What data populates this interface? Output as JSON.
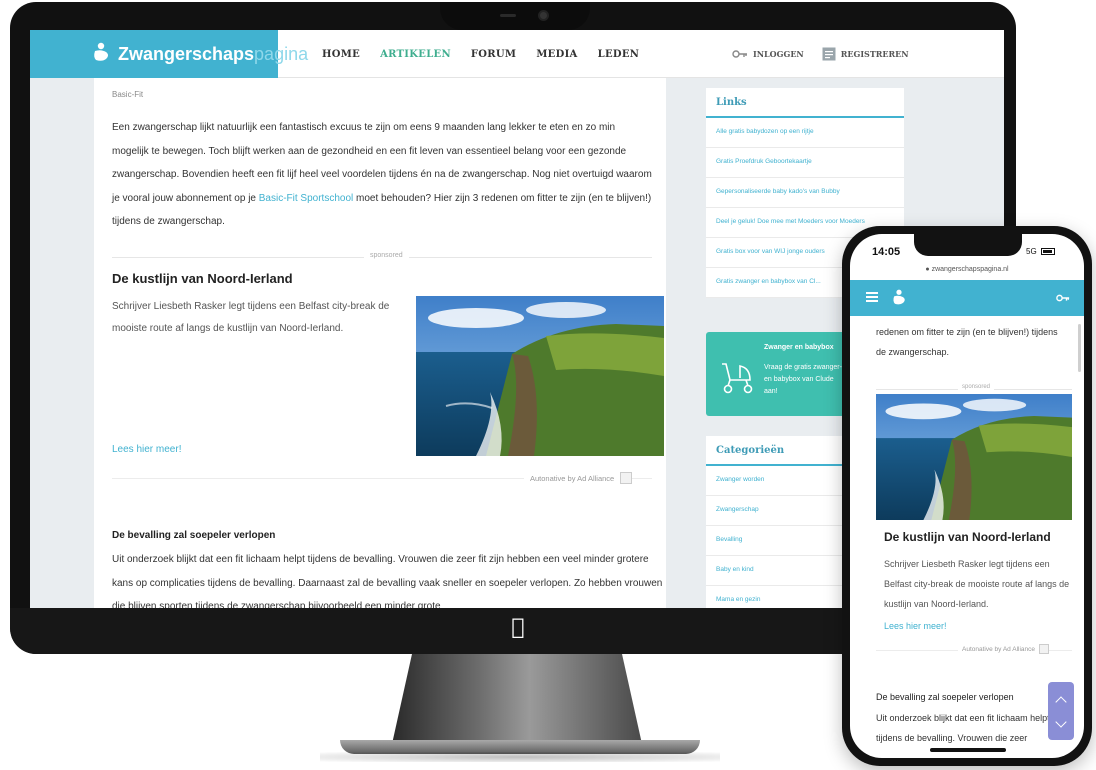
{
  "site": {
    "logo_bold": "Zwangerschaps",
    "logo_light": "pagina",
    "nav": [
      "HOME",
      "ARTIKELEN",
      "FORUM",
      "MEDIA",
      "LEDEN"
    ],
    "active_nav": "ARTIKELEN",
    "login_label": "INLOGGEN",
    "register_label": "REGISTREREN",
    "brand_color": "#41b2d0",
    "accent_color": "#3fae8f"
  },
  "article": {
    "breadcrumb": "Basic-Fit",
    "intro_before_link": "Een zwangerschap lijkt natuurlijk een fantastisch excuus te zijn om eens 9 maanden lang lekker te eten en zo min mogelijk te bewegen. Toch blijft werken aan de gezondheid en een fit leven van essentieel belang voor een gezonde zwangerschap. Bovendien heeft een fit lijf heel veel voordelen tijdens én na de zwangerschap. Nog niet overtuigd waarom je vooral jouw abonnement op je ",
    "intro_link": "Basic-Fit Sportschool",
    "intro_after_link": " moet behouden? Hier zijn 3 redenen om fitter te zijn (en te blijven!) tijdens de zwangerschap.",
    "sponsored_label": "sponsored",
    "ad_title": "De kustlijn van Noord-Ierland",
    "ad_desc": "Schrijver Liesbeth Rasker legt tijdens een Belfast city-break de mooiste route af langs de kustlijn van Noord-Ierland.",
    "ad_link": "Lees hier meer!",
    "ad_powered": "Autonative by Ad Alliance",
    "section_title": "De bevalling zal soepeler verlopen",
    "section_text": "Uit onderzoek blijkt dat een fit lichaam helpt tijdens de bevalling. Vrouwen die zeer fit zijn hebben een veel minder grotere kans op complicaties tijdens de bevalling. Daarnaast zal de bevalling vaak sneller en soepeler verlopen. Zo hebben vrouwen die blijven sporten tijdens de zwangerschap bijvoorbeeld een minder grote"
  },
  "sidebar": {
    "links_title": "Links",
    "links": [
      "Alle gratis babydozen op een rijtje",
      "Gratis Proefdruk Geboortekaartje",
      "Gepersonaliseerde baby kado's van Bubby",
      "Deel je geluk! Doe mee met Moeders voor Moeders",
      "Gratis box voor van WIJ jonge ouders",
      "Gratis zwanger en babybox van Cl..."
    ],
    "promo_title": "Zwanger en babybox",
    "promo_text": "Vraag de gratis zwanger- en babybox van Clude aan!",
    "categories_title": "Categorieën",
    "categories": [
      "Zwanger worden",
      "Zwangerschap",
      "Bevalling",
      "Baby en kind",
      "Mama en gezin"
    ]
  },
  "phone": {
    "time": "14:05",
    "network": "5G",
    "url": "zwangerschapspagina.nl",
    "intro": "redenen om fitter te zijn (en te blijven!) tijdens de zwangerschap.",
    "sponsored_label": "sponsored",
    "ad_title": "De kustlijn van Noord-Ierland",
    "ad_desc": "Schrijver Liesbeth Rasker legt tijdens een Belfast city-break de mooiste route af langs de kustlijn van Noord-Ierland.",
    "ad_link": "Lees hier meer!",
    "ad_powered": "Autonative by Ad Alliance",
    "section_title": "De bevalling zal soepeler verlopen",
    "section_text": "Uit onderzoek blijkt dat een fit lichaam helpt tijdens de bevalling. Vrouwen die zeer"
  }
}
